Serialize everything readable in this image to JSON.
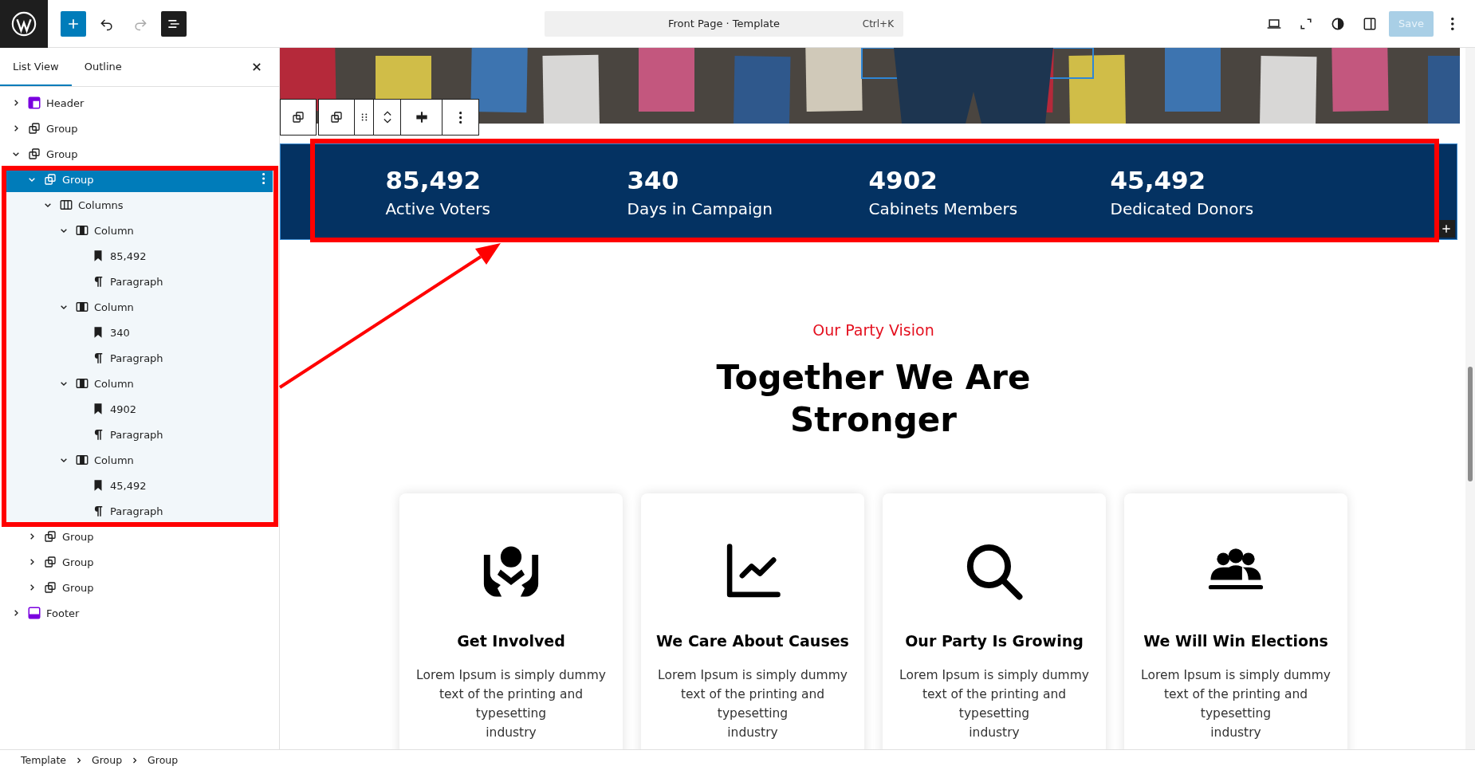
{
  "topbar": {
    "command_label": "Front Page · Template",
    "shortcut": "Ctrl+K",
    "save": {
      "label": "Save",
      "disabled": true
    },
    "list_view_toggle": {
      "selected": true
    }
  },
  "sidebar": {
    "tabs": [
      {
        "label": "List View",
        "selected": true
      },
      {
        "label": "Outline",
        "selected": false
      }
    ],
    "tree": [
      {
        "kind": "header",
        "label": "Header",
        "expanded": false,
        "selected": false
      },
      {
        "kind": "group",
        "label": "Group",
        "expanded": false,
        "selected": false
      },
      {
        "kind": "group",
        "label": "Group",
        "expanded": true,
        "selected": false,
        "children": [
          {
            "kind": "group",
            "label": "Group",
            "expanded": true,
            "selected": true,
            "children": [
              {
                "kind": "columns",
                "label": "Columns",
                "expanded": true,
                "selected": false,
                "children": [
                  {
                    "kind": "column",
                    "label": "Column",
                    "expanded": true,
                    "selected": false,
                    "children": [
                      {
                        "kind": "heading",
                        "label": "85,492",
                        "selected": false
                      },
                      {
                        "kind": "paragraph",
                        "label": "Paragraph",
                        "selected": false
                      }
                    ]
                  },
                  {
                    "kind": "column",
                    "label": "Column",
                    "expanded": true,
                    "selected": false,
                    "children": [
                      {
                        "kind": "heading",
                        "label": "340",
                        "selected": false
                      },
                      {
                        "kind": "paragraph",
                        "label": "Paragraph",
                        "selected": false
                      }
                    ]
                  },
                  {
                    "kind": "column",
                    "label": "Column",
                    "expanded": true,
                    "selected": false,
                    "children": [
                      {
                        "kind": "heading",
                        "label": "4902",
                        "selected": false
                      },
                      {
                        "kind": "paragraph",
                        "label": "Paragraph",
                        "selected": false
                      }
                    ]
                  },
                  {
                    "kind": "column",
                    "label": "Column",
                    "expanded": true,
                    "selected": false,
                    "children": [
                      {
                        "kind": "heading",
                        "label": "45,492",
                        "selected": false
                      },
                      {
                        "kind": "paragraph",
                        "label": "Paragraph",
                        "selected": false
                      }
                    ]
                  }
                ]
              }
            ]
          },
          {
            "kind": "group",
            "label": "Group",
            "expanded": false,
            "selected": false
          },
          {
            "kind": "group",
            "label": "Group",
            "expanded": false,
            "selected": false
          },
          {
            "kind": "group",
            "label": "Group",
            "expanded": false,
            "selected": false
          }
        ]
      },
      {
        "kind": "footer",
        "label": "Footer",
        "expanded": false,
        "selected": false
      }
    ]
  },
  "canvas": {
    "stats": [
      {
        "value": "85,492",
        "label": "Active Voters"
      },
      {
        "value": "340",
        "label": "Days in Campaign"
      },
      {
        "value": "4902",
        "label": "Cabinets Members"
      },
      {
        "value": "45,492",
        "label": "Dedicated Donors"
      }
    ],
    "vision": {
      "eyebrow": "Our Party Vision",
      "heading": "Together We Are Stronger"
    },
    "cards": [
      {
        "kind": "hands",
        "title": "Get Involved",
        "text": "Lorem Ipsum is simply dummy text of the printing and typesetting\nindustry"
      },
      {
        "kind": "chart",
        "title": "We Care About Causes",
        "text": "Lorem Ipsum is simply dummy text of the printing and typesetting\nindustry"
      },
      {
        "kind": "search",
        "title": "Our Party Is Growing",
        "text": "Lorem Ipsum is simply dummy text of the printing and typesetting\nindustry"
      },
      {
        "kind": "people",
        "title": "We Will Win Elections",
        "text": "Lorem Ipsum is simply dummy text of the printing and typesetting\nindustry"
      }
    ]
  },
  "breadcrumb": [
    "Template",
    "Group",
    "Group"
  ]
}
